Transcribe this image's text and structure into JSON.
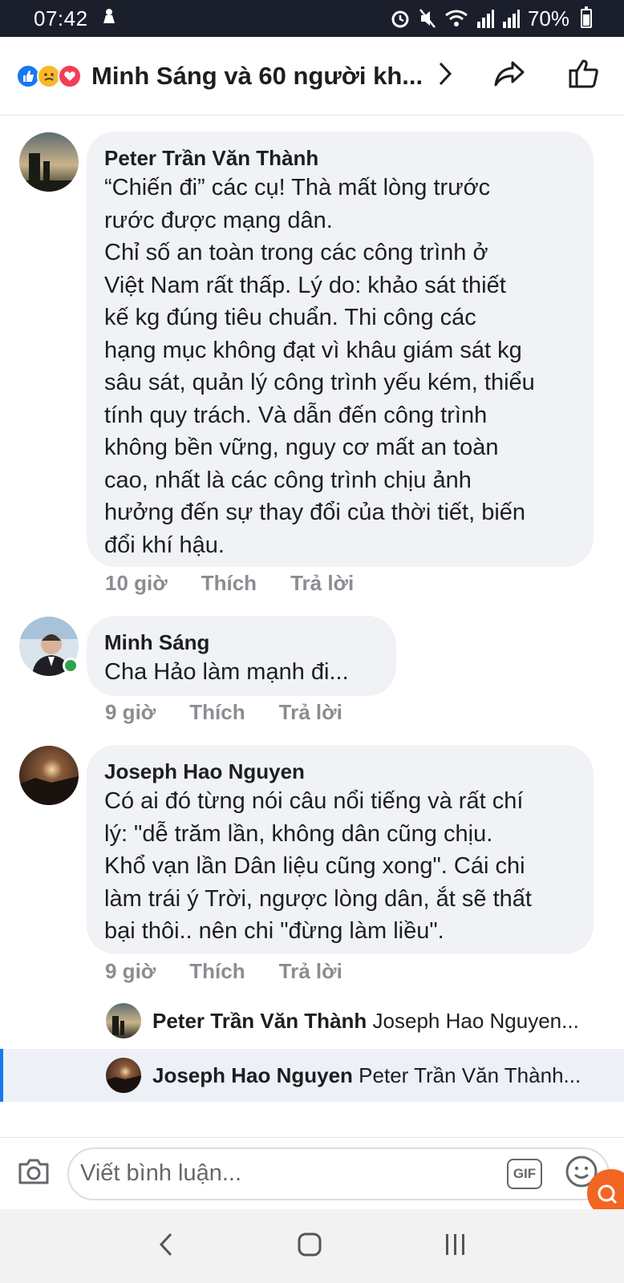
{
  "status_bar": {
    "time": "07:42",
    "battery": "70%"
  },
  "header": {
    "title": "Minh Sáng và 60 người kh...",
    "reactions": [
      "like-icon",
      "sad-icon",
      "love-icon"
    ]
  },
  "comments": [
    {
      "author": "Peter Trần Văn Thành",
      "lines": [
        "“Chiến đi” các cụ! Thà mất lòng trước",
        "rước được mạng dân.",
        "Chỉ số an toàn trong các công trình ở",
        "Việt Nam rất thấp. Lý do: khảo sát thiết",
        "kế kg đúng tiêu chuẩn. Thi công các",
        "hạng mục không đạt vì khâu giám sát kg",
        "sâu sát, quản lý công trình yếu kém, thiểu",
        "tính quy trách. Và dẫn đến công trình",
        "không bền vững, nguy cơ mất an toàn",
        "cao, nhất là các công trình chịu ảnh",
        "hưởng đến sự thay đổi của thời tiết, biến",
        "đổi khí hậu."
      ],
      "time": "10 giờ",
      "like": "Thích",
      "reply": "Trả lời"
    },
    {
      "author": "Minh Sáng",
      "lines": [
        "Cha Hảo làm mạnh đi..."
      ],
      "time": "9 giờ",
      "like": "Thích",
      "reply": "Trả lời"
    },
    {
      "author": "Joseph Hao Nguyen",
      "lines": [
        "Có ai đó từng nói câu nổi tiếng và rất chí",
        "lý: \"dễ trăm lần, không dân cũng chịu.",
        "Khổ vạn lần Dân liệu cũng xong\". Cái chi",
        "làm trái ý Trời, ngược lòng dân, ắt sẽ thất",
        "bại thôi.. nên chi \"đừng làm liều\"."
      ],
      "time": "9 giờ",
      "like": "Thích",
      "reply": "Trả lời"
    }
  ],
  "replies": [
    {
      "author": "Peter Trần Văn Thành",
      "preview": "Joseph Hao Nguyen..."
    },
    {
      "author": "Joseph Hao Nguyen",
      "preview": "Peter Trần Văn Thành..."
    }
  ],
  "composer": {
    "placeholder": "Viết bình luận...",
    "gif_label": "GIF"
  },
  "colors": {
    "accent": "#1877f2",
    "bubble": "#f0f2f5",
    "meta": "#8a8d91",
    "online": "#31a24c"
  }
}
